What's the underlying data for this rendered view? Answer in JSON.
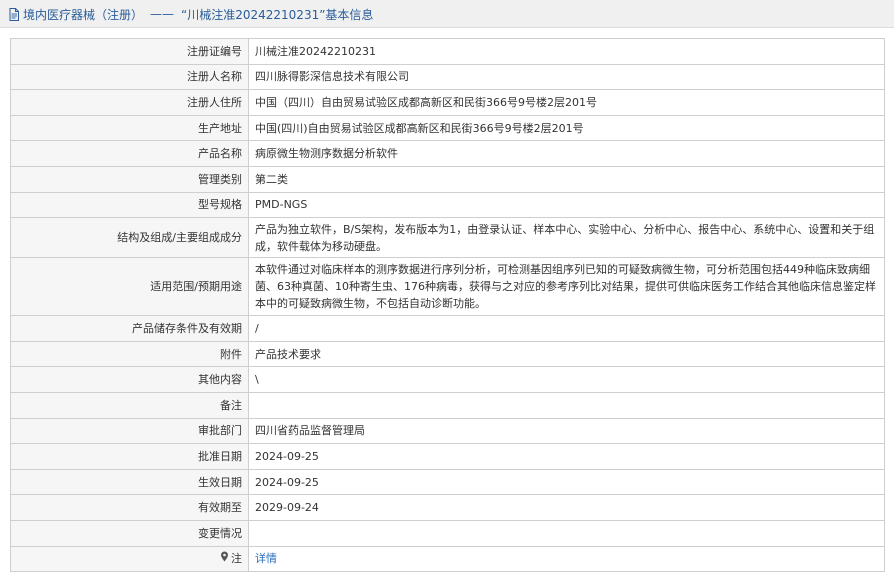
{
  "header": {
    "category": "境内医疗器械（注册）",
    "separator": "——",
    "record_title": "“川械注准20242210231”基本信息"
  },
  "rows": [
    {
      "label": "注册证编号",
      "value": "川械注准20242210231"
    },
    {
      "label": "注册人名称",
      "value": "四川脉得影深信息技术有限公司"
    },
    {
      "label": "注册人住所",
      "value": "中国（四川）自由贸易试验区成都高新区和民街366号9号楼2层201号"
    },
    {
      "label": "生产地址",
      "value": "中国(四川)自由贸易试验区成都高新区和民街366号9号楼2层201号"
    },
    {
      "label": "产品名称",
      "value": "病原微生物测序数据分析软件"
    },
    {
      "label": "管理类别",
      "value": "第二类"
    },
    {
      "label": "型号规格",
      "value": "PMD-NGS"
    },
    {
      "label": "结构及组成/主要组成成分",
      "value": "产品为独立软件，B/S架构，发布版本为1，由登录认证、样本中心、实验中心、分析中心、报告中心、系统中心、设置和关于组成，软件载体为移动硬盘。"
    },
    {
      "label": "适用范围/预期用途",
      "value": "本软件通过对临床样本的测序数据进行序列分析，可检测基因组序列已知的可疑致病微生物，可分析范围包括449种临床致病细菌、63种真菌、10种寄生虫、176种病毒，获得与之对应的参考序列比对结果，提供可供临床医务工作结合其他临床信息鉴定样本中的可疑致病微生物，不包括自动诊断功能。"
    },
    {
      "label": "产品储存条件及有效期",
      "value": "/"
    },
    {
      "label": "附件",
      "value": "产品技术要求"
    },
    {
      "label": "其他内容",
      "value": "\\"
    },
    {
      "label": "备注",
      "value": ""
    },
    {
      "label": "审批部门",
      "value": "四川省药品监督管理局"
    },
    {
      "label": "批准日期",
      "value": "2024-09-25"
    },
    {
      "label": "生效日期",
      "value": "2024-09-25"
    },
    {
      "label": "有效期至",
      "value": "2029-09-24"
    },
    {
      "label": "变更情况",
      "value": ""
    }
  ],
  "note_row": {
    "label": "注",
    "link_text": "详情",
    "icon": "pin-icon"
  },
  "colors": {
    "accent": "#2a5c9a",
    "link": "#2a6ebb",
    "label_bg": "#f6f6f6",
    "border": "#cfcfcf"
  }
}
